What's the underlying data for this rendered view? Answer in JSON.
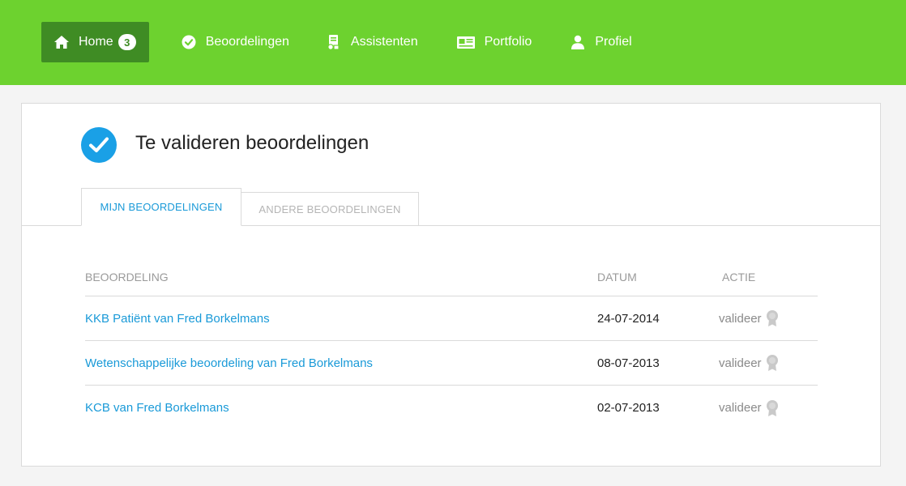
{
  "nav": {
    "items": [
      {
        "label": "Home",
        "icon": "home-icon",
        "badge": "3",
        "active": true
      },
      {
        "label": "Beoordelingen",
        "icon": "check-circle-icon"
      },
      {
        "label": "Assistenten",
        "icon": "assistants-icon"
      },
      {
        "label": "Portfolio",
        "icon": "portfolio-icon"
      },
      {
        "label": "Profiel",
        "icon": "user-icon"
      }
    ]
  },
  "page": {
    "title": "Te valideren beoordelingen",
    "title_icon": "check-circle-icon"
  },
  "tabs": [
    {
      "label": "MIJN BEOORDELINGEN",
      "active": true
    },
    {
      "label": "ANDERE BEOORDELINGEN",
      "active": false
    }
  ],
  "table": {
    "headers": {
      "beoordeling": "BEOORDELING",
      "datum": "DATUM",
      "actie": "ACTIE"
    },
    "rows": [
      {
        "beoordeling": "KKB Patiënt van Fred Borkelmans",
        "datum": "24-07-2014",
        "actie": "valideer"
      },
      {
        "beoordeling": "Wetenschappelijke beoordeling van Fred Borkelmans",
        "datum": "08-07-2013",
        "actie": "valideer"
      },
      {
        "beoordeling": "KCB van Fred Borkelmans",
        "datum": "02-07-2013",
        "actie": "valideer"
      }
    ]
  },
  "colors": {
    "topbar": "#6dd22f",
    "active_nav": "#3f8c24",
    "link": "#1a9ad8",
    "accent_icon": "#1aa0e6"
  }
}
